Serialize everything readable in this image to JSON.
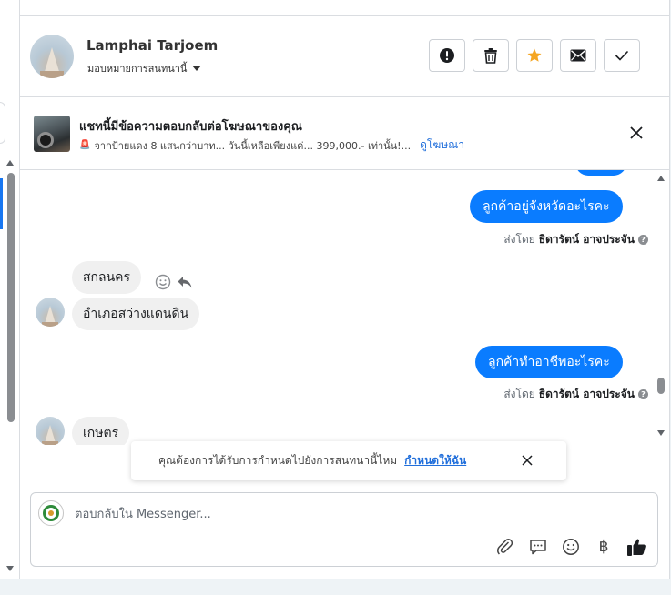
{
  "conversation": {
    "contact_name": "Lamphai Tarjoem",
    "assign_label": "มอบหมายการสนทนานี้"
  },
  "actions": [
    {
      "name": "mark-spam-button",
      "icon": "exclamation-circle-icon"
    },
    {
      "name": "delete-button",
      "icon": "trash-icon"
    },
    {
      "name": "star-button",
      "icon": "star-icon",
      "color": "#f5a623"
    },
    {
      "name": "mark-unread-button",
      "icon": "envelope-icon"
    },
    {
      "name": "mark-done-button",
      "icon": "checkmark-icon"
    }
  ],
  "ad_reply": {
    "title": "แชทนี้มีข้อความตอบกลับต่อโฆษณาของคุณ",
    "snippet": "จากป้ายแดง 8 แสนกว่าบาท... วันนี้เหลือเพียงแค่... 399,000.- เท่านั้น!...",
    "link_label": "ดูโฆษณา"
  },
  "messages": {
    "out1": {
      "text": "ลูกค้าอยู่จังหวัดอะไรคะ"
    },
    "sent_by_1": {
      "prefix": "ส่งโดย",
      "name": "ธิดารัตน์ อาจประจัน"
    },
    "in1": {
      "text": "สกลนคร"
    },
    "in2": {
      "text": "อำเภอสว่างแดนดิน"
    },
    "out2": {
      "text": "ลูกค้าทำอาชีพอะไรคะ"
    },
    "sent_by_2": {
      "prefix": "ส่งโดย",
      "name": "ธิดารัตน์ อาจประจัน"
    },
    "in3": {
      "text": "เกษตร"
    }
  },
  "reminder": {
    "text": "คุณต้องการได้รับการกำหนดไปยังการสนทนานี้ไหม",
    "link_label": "กำหนดให้ฉัน"
  },
  "composer": {
    "placeholder": "ตอบกลับใน Messenger..."
  },
  "colors": {
    "accent": "#0a7cff",
    "link": "#216fdb",
    "star": "#f5a623"
  }
}
